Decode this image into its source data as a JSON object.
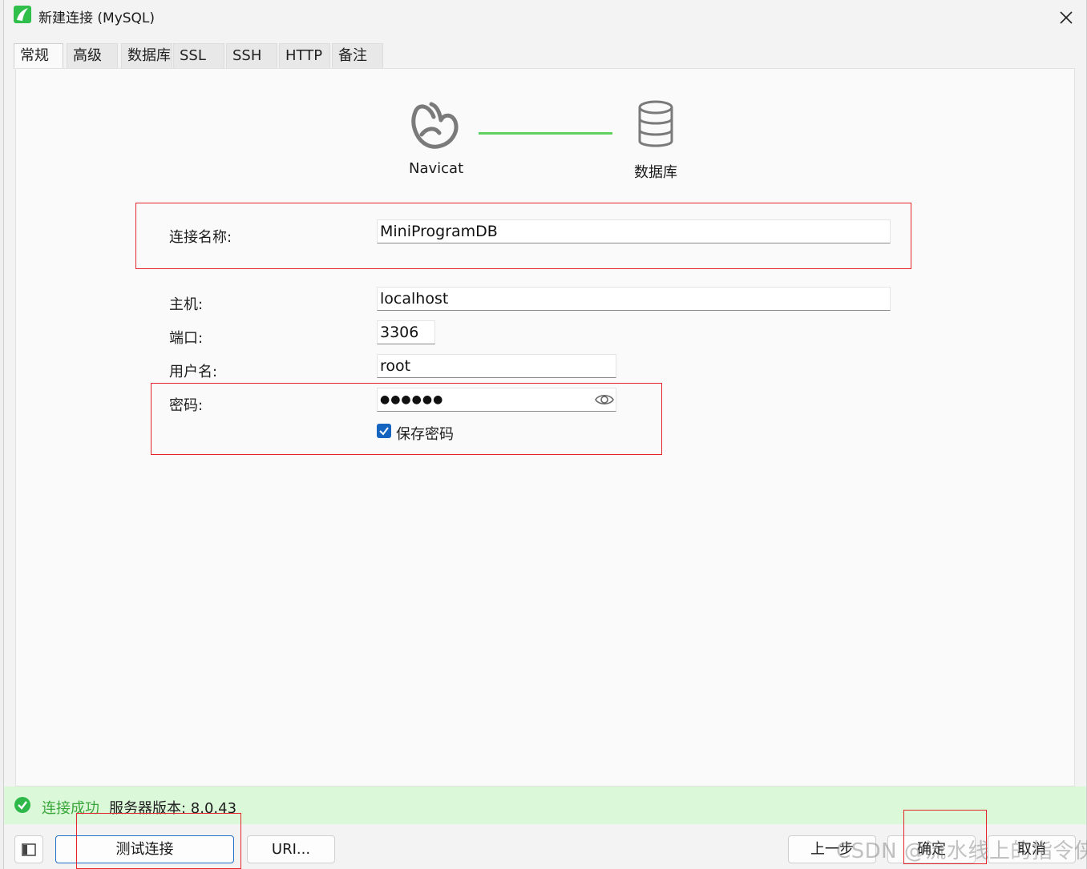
{
  "window": {
    "title": "新建连接 (MySQL)",
    "close_glyph": "✕",
    "app_icon": "navicat-logo-icon"
  },
  "tabs": [
    {
      "label": "常规",
      "active": true
    },
    {
      "label": "高级"
    },
    {
      "label": "数据库"
    },
    {
      "label": "SSL"
    },
    {
      "label": "SSH"
    },
    {
      "label": "HTTP"
    },
    {
      "label": "备注"
    }
  ],
  "diagram": {
    "left_label": "Navicat",
    "right_label": "数据库",
    "link_color": "#5fd15f"
  },
  "form": {
    "connection_name_label": "连接名称:",
    "connection_name_value": "MiniProgramDB",
    "host_label": "主机:",
    "host_value": "localhost",
    "port_label": "端口:",
    "port_value": "3306",
    "username_label": "用户名:",
    "username_value": "root",
    "password_label": "密码:",
    "password_mask": "●●●●●●",
    "save_password_label": "保存密码",
    "save_password_checked": true
  },
  "status": {
    "success_text": "连接成功",
    "version_text": "服务器版本: 8.0.43",
    "success_color": "#3aa63a"
  },
  "buttons": {
    "test_connection": "测试连接",
    "uri": "URI...",
    "previous": "上一步",
    "ok": "确定",
    "cancel": "取消"
  },
  "watermark": "CSDN @流水线上的指令侠",
  "colors": {
    "highlight_box": "#e2262b",
    "checkbox": "#1565c0",
    "status_bg": "#dbf8d9"
  }
}
